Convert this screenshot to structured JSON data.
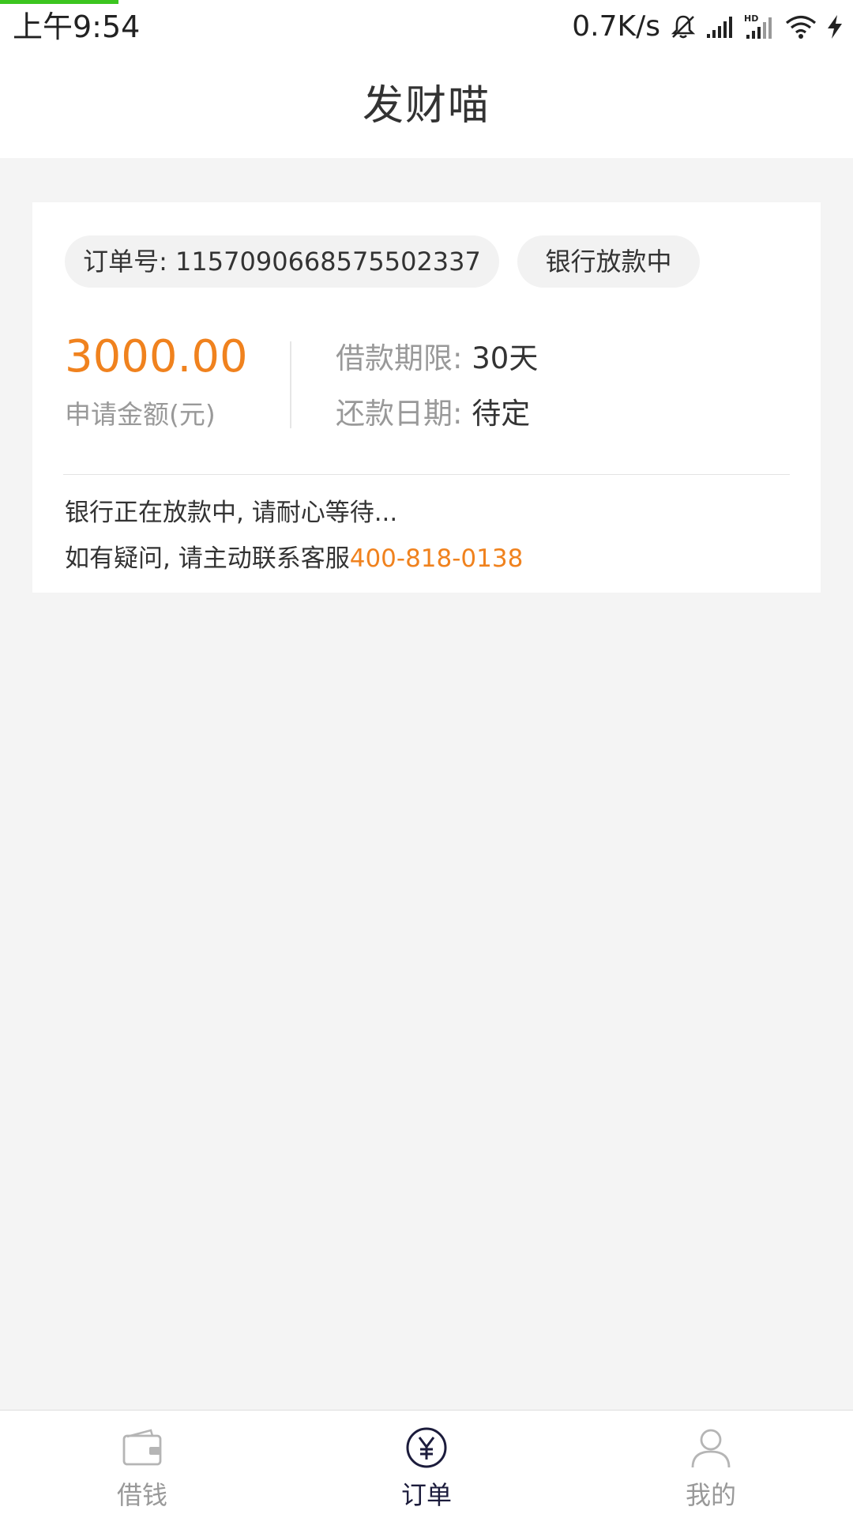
{
  "status_bar": {
    "time": "上午9:54",
    "network_speed": "0.7K/s",
    "icons": [
      "mute-bell-icon",
      "signal-icon",
      "hd-signal-icon",
      "wifi-icon",
      "charging-icon"
    ]
  },
  "header": {
    "title": "发财喵"
  },
  "order": {
    "order_number": "订单号: 1157090668575502337",
    "status": "银行放款中",
    "amount": "3000.00",
    "amount_label": "申请金额(元)",
    "term_key": "借款期限: ",
    "term_value": "30天",
    "repay_key": "还款日期: ",
    "repay_value": "待定",
    "notice_line1": "银行正在放款中, 请耐心等待...",
    "notice_line2_prefix": "如有疑问, 请主动联系客服",
    "notice_phone": "400-818-0138"
  },
  "tab_bar": {
    "items": [
      {
        "label": "借钱",
        "icon": "wallet-icon",
        "active": false
      },
      {
        "label": "订单",
        "icon": "yuan-circle-icon",
        "active": true
      },
      {
        "label": "我的",
        "icon": "user-icon",
        "active": false
      }
    ]
  },
  "colors": {
    "accent": "#f0821e",
    "background": "#f4f4f4",
    "active_tab": "#1c1c3c"
  }
}
